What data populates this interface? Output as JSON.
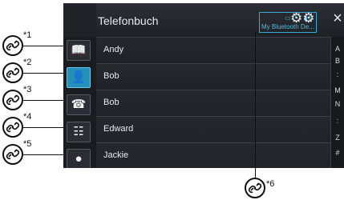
{
  "header": {
    "title": "Telefonbuch",
    "status_icons": "▭ ᵀᵢˡ ▮1",
    "device_name": "My Bluetooth De..."
  },
  "buttons": {
    "settings_glyph": "⚙⚙",
    "close_glyph": "×"
  },
  "source_buttons": [
    {
      "glyph": "📖",
      "icon": "book-icon"
    },
    {
      "glyph": "👤",
      "icon": "contact-icon"
    },
    {
      "glyph": "☎",
      "icon": "call-history-icon"
    },
    {
      "glyph": "☷",
      "icon": "keypad-icon"
    },
    {
      "glyph": "●",
      "icon": "voice-icon"
    }
  ],
  "contacts": [
    "Andy",
    "Bob",
    "Bob",
    "Edward",
    "Jackie"
  ],
  "index": [
    "A",
    "B",
    ":",
    "M",
    "N",
    ":",
    "Z",
    "#"
  ],
  "callouts": [
    "*1",
    "*2",
    "*3",
    "*4",
    "*5",
    "*6"
  ],
  "colors": {
    "accent": "#2590b8",
    "device_text": "#4bbde6",
    "background": "#1f2227"
  }
}
